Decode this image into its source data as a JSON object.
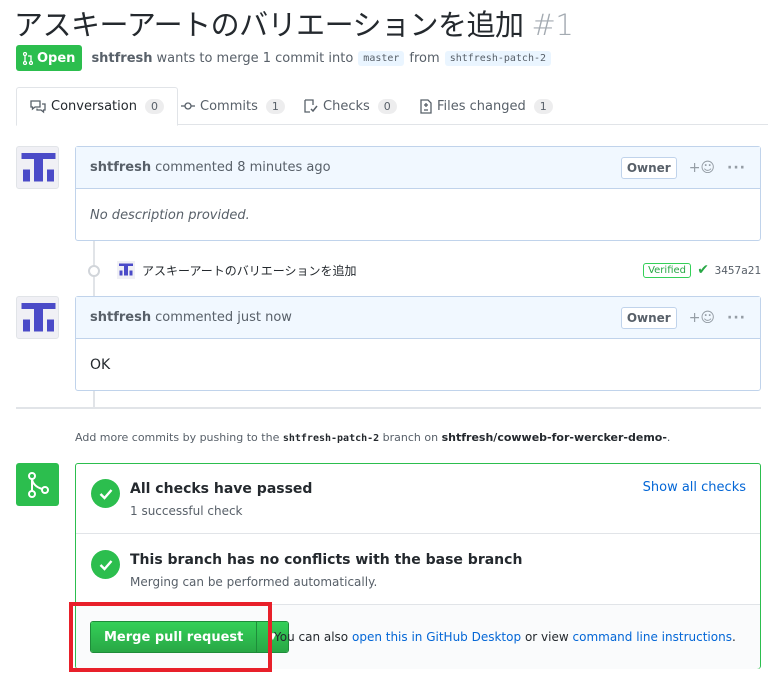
{
  "pr": {
    "title": "アスキーアートのバリエーションを追加",
    "number": "#1",
    "state": "Open",
    "author": "shtfresh",
    "summary_mid": "wants to merge 1 commit into",
    "base_branch": "master",
    "from_word": "from",
    "head_branch": "shtfresh-patch-2"
  },
  "tabs": [
    {
      "label": "Conversation",
      "count": "0"
    },
    {
      "label": "Commits",
      "count": "1"
    },
    {
      "label": "Checks",
      "count": "0"
    },
    {
      "label": "Files changed",
      "count": "1"
    }
  ],
  "comments": [
    {
      "author": "shtfresh",
      "action": "commented 8 minutes ago",
      "badge": "Owner",
      "body": "No description provided."
    },
    {
      "author": "shtfresh",
      "action": "commented just now",
      "badge": "Owner",
      "body": "OK"
    }
  ],
  "commit": {
    "message": "アスキーアートのバリエーションを追加",
    "verified": "Verified",
    "sha": "3457a21"
  },
  "hint": {
    "prefix": "Add more commits by pushing to the",
    "branch": "shtfresh-patch-2",
    "middle": "branch on",
    "repo": "shtfresh/cowweb-for-wercker-demo-",
    "suffix": "."
  },
  "merge_box": {
    "checks_title": "All checks have passed",
    "checks_sub": "1 successful check",
    "show_all": "Show all checks",
    "conflict_title": "This branch has no conflicts with the base branch",
    "conflict_sub": "Merging can be performed automatically.",
    "merge_button": "Merge pull request",
    "alt_prefix": "You can also",
    "desktop_link": "open this in GitHub Desktop",
    "alt_middle": "or view",
    "cli_link": "command line instructions",
    "alt_suffix": "."
  },
  "colors": {
    "green": "#2cbe4e",
    "link": "#0366d6",
    "highlight": "#e8202a",
    "avatar": "#4b4bc8"
  },
  "icons": {
    "state": "git-pull-request-icon",
    "conversation": "comment-discussion-icon",
    "commits": "git-commit-icon",
    "checks": "checklist-icon",
    "files": "file-diff-icon",
    "merge": "git-merge-icon"
  }
}
